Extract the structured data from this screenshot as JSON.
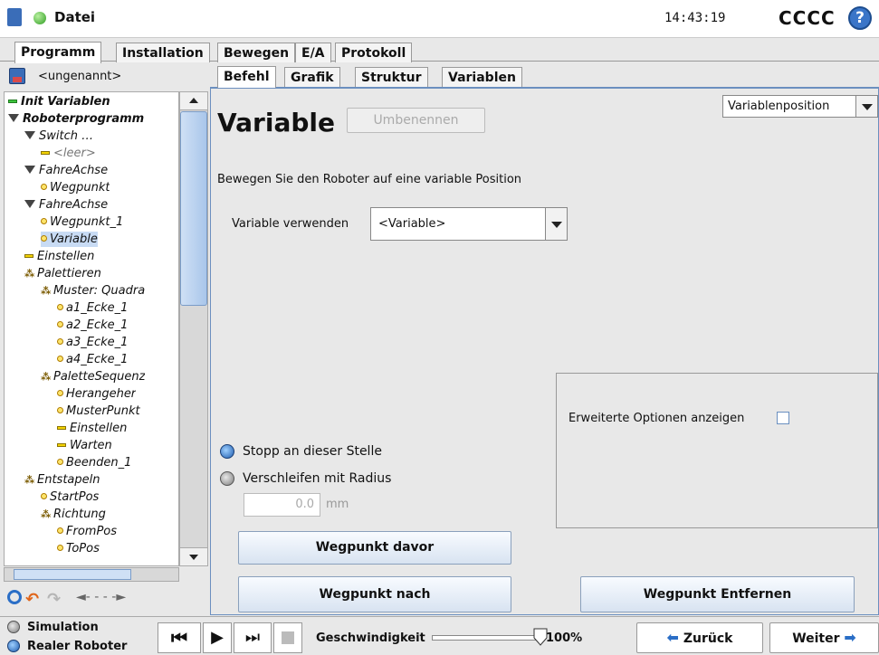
{
  "header": {
    "file_label": "Datei",
    "time": "14:43:19",
    "robot_name": "CCCC",
    "help_icon": "?"
  },
  "main_tabs": [
    "Programm",
    "Installation",
    "Bewegen",
    "E/A",
    "Protokoll"
  ],
  "file": {
    "name": "<ungenannt>"
  },
  "sub_tabs": [
    "Befehl",
    "Grafik",
    "Struktur",
    "Variablen"
  ],
  "tree": [
    {
      "label": "Init Variablen",
      "icon": "green-bar",
      "bold": true
    },
    {
      "label": "Roboterprogramm",
      "icon": "triangle",
      "bold": true
    },
    {
      "label": "Switch …",
      "icon": "triangle"
    },
    {
      "label": "<leer>",
      "icon": "yellow-bar",
      "dim": true
    },
    {
      "label": "FahreAchse",
      "icon": "triangle"
    },
    {
      "label": "Wegpunkt",
      "icon": "dot"
    },
    {
      "label": "FahreAchse",
      "icon": "triangle"
    },
    {
      "label": "Wegpunkt_1",
      "icon": "dot"
    },
    {
      "label": "Variable",
      "icon": "dot",
      "selected": true
    },
    {
      "label": "Einstellen",
      "icon": "yellow-bar"
    },
    {
      "label": "Palettieren",
      "icon": "pallet"
    },
    {
      "label": "Muster: Quadra",
      "icon": "pallet"
    },
    {
      "label": "a1_Ecke_1",
      "icon": "dot"
    },
    {
      "label": "a2_Ecke_1",
      "icon": "dot"
    },
    {
      "label": "a3_Ecke_1",
      "icon": "dot"
    },
    {
      "label": "a4_Ecke_1",
      "icon": "dot"
    },
    {
      "label": "PaletteSequenz",
      "icon": "pallet"
    },
    {
      "label": "Herangeher",
      "icon": "dot"
    },
    {
      "label": "MusterPunkt",
      "icon": "dot"
    },
    {
      "label": "Einstellen",
      "icon": "yellow-bar"
    },
    {
      "label": "Warten",
      "icon": "yellow-bar"
    },
    {
      "label": "Beenden_1",
      "icon": "dot"
    },
    {
      "label": "Entstapeln",
      "icon": "pallet"
    },
    {
      "label": "StartPos",
      "icon": "dot"
    },
    {
      "label": "Richtung",
      "icon": "pallet"
    },
    {
      "label": "FromPos",
      "icon": "dot"
    },
    {
      "label": "ToPos",
      "icon": "dot"
    }
  ],
  "panel": {
    "title": "Variable",
    "rename_button": "Umbenennen",
    "position_select": "Variablenposition",
    "description": "Bewegen Sie den Roboter auf eine variable Position",
    "use_variable_label": "Variable verwenden",
    "use_variable_value": "<Variable>",
    "advanced_options_label": "Erweiterte Optionen anzeigen",
    "stop_label": "Stopp an dieser Stelle",
    "blend_label": "Verschleifen mit Radius",
    "radius_value": "0.0",
    "radius_unit": "mm",
    "waypoint_before": "Wegpunkt davor",
    "waypoint_after": "Wegpunkt nach",
    "waypoint_remove": "Wegpunkt Entfernen"
  },
  "footer": {
    "simulation": "Simulation",
    "real_robot": "Realer Roboter",
    "speed_label": "Geschwindigkeit",
    "speed_value": "100%",
    "speed_fraction": 1.0,
    "back": "Zurück",
    "next": "Weiter"
  },
  "colors": {
    "accent": "#2a6ec6",
    "selected": "#c8dbf4",
    "panel_border": "#6b8fbf"
  }
}
